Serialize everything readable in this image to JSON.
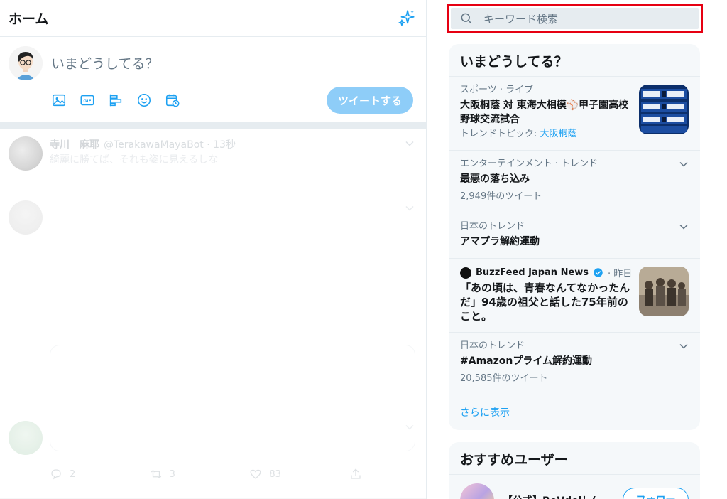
{
  "timeline": {
    "title": "ホーム",
    "compose_placeholder": "いまどうしてる？",
    "tweet_button": "ツイートする",
    "tweets": [
      {
        "name": "寺川　麻耶",
        "handle": "@TerakawaMayaBot · 13秒",
        "text": "綺麗に勝てば、それも姿に見えるしな"
      },
      {
        "name": "",
        "handle": "",
        "text": ""
      },
      {
        "name": "",
        "handle": "",
        "text": "",
        "reply_count": "2",
        "retweet_count": "3",
        "like_count": "83"
      }
    ]
  },
  "search": {
    "placeholder": "キーワード検索"
  },
  "trends": {
    "title": "いまどうしてる？",
    "items": [
      {
        "meta": "スポーツ · ライブ",
        "title": "大阪桐蔭 対 東海大相模⚾甲子園高校野球交流試合",
        "sub_prefix": "トレンドトピック: ",
        "sub_link": "大阪桐蔭"
      },
      {
        "meta": "エンターテインメント · トレンド",
        "title": "最悪の落ち込み",
        "sub": "2,949件のツイート"
      },
      {
        "meta": "日本のトレンド",
        "title": "アマプラ解約運動"
      },
      {
        "source": "BuzzFeed Japan News",
        "time": "· 昨日",
        "title": "「あの頃は、青春なんてなかったんだ」94歳の祖父と話した75年前のこと。"
      },
      {
        "meta": "日本のトレンド",
        "title": "#Amazonプライム解約運動",
        "sub": "20,585件のツイート"
      }
    ],
    "show_more": "さらに表示"
  },
  "recommend": {
    "title": "おすすめユーザー",
    "user_name": "【公式】ReVdol！(...",
    "follow_button": "フォロー"
  },
  "colors": {
    "accent": "#1da1f2",
    "highlight": "#e60012",
    "panel": "#f5f8fa"
  }
}
